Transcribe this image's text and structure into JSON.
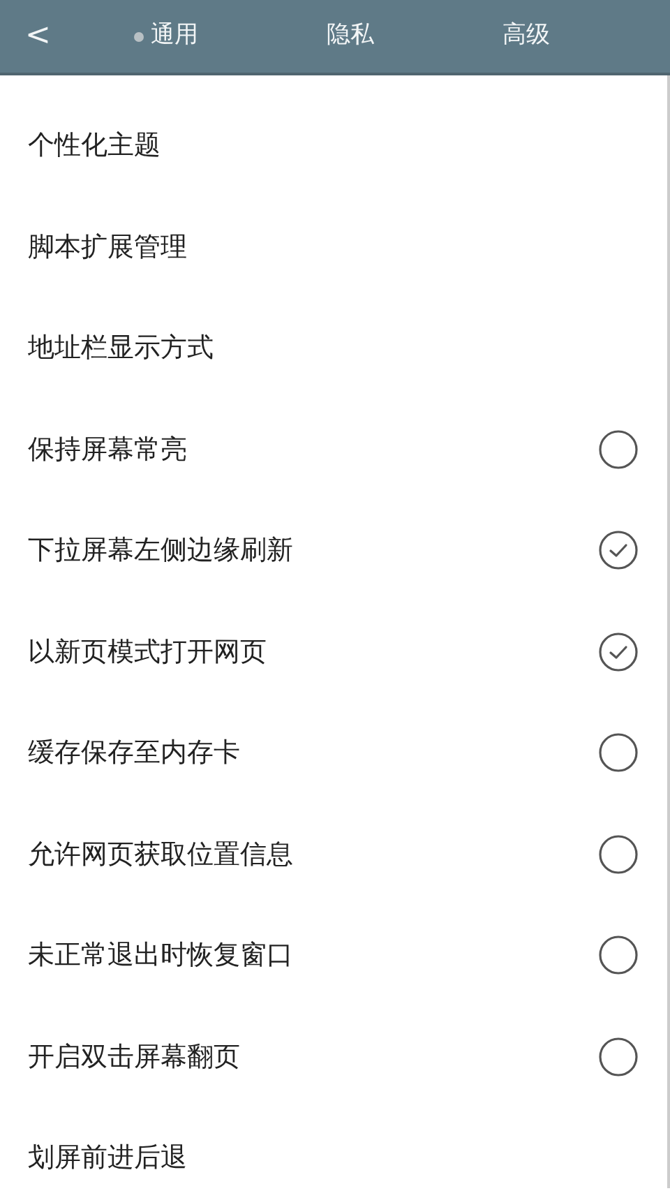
{
  "header": {
    "back": "<",
    "tabs": [
      {
        "label": "通用",
        "selected": true
      },
      {
        "label": "隐私",
        "selected": false
      },
      {
        "label": "高级",
        "selected": false
      }
    ]
  },
  "settings": [
    {
      "label": "个性化主题",
      "kind": "link"
    },
    {
      "label": "脚本扩展管理",
      "kind": "link"
    },
    {
      "label": "地址栏显示方式",
      "kind": "link"
    },
    {
      "label": "保持屏幕常亮",
      "kind": "check",
      "checked": false
    },
    {
      "label": "下拉屏幕左侧边缘刷新",
      "kind": "check",
      "checked": true
    },
    {
      "label": "以新页模式打开网页",
      "kind": "check",
      "checked": true
    },
    {
      "label": "缓存保存至内存卡",
      "kind": "check",
      "checked": false
    },
    {
      "label": "允许网页获取位置信息",
      "kind": "check",
      "checked": false
    },
    {
      "label": "未正常退出时恢复窗口",
      "kind": "check",
      "checked": false
    },
    {
      "label": "开启双击屏幕翻页",
      "kind": "check",
      "checked": false
    },
    {
      "label": "划屏前进后退",
      "kind": "link"
    }
  ]
}
